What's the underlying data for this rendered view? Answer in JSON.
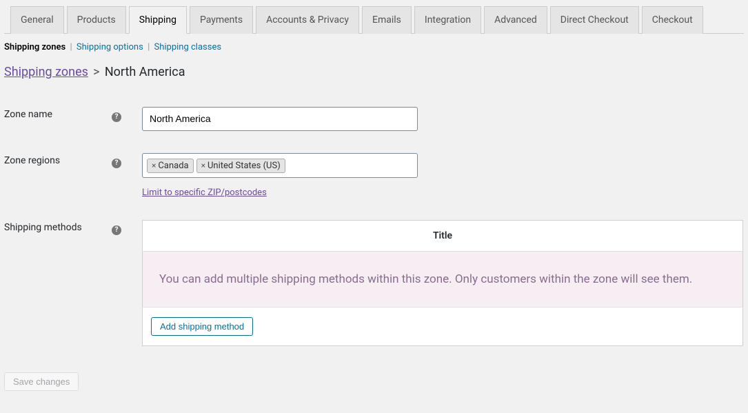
{
  "tabs": [
    "General",
    "Products",
    "Shipping",
    "Payments",
    "Accounts & Privacy",
    "Emails",
    "Integration",
    "Advanced",
    "Direct Checkout",
    "Checkout"
  ],
  "active_tab_index": 2,
  "subnav": {
    "items": [
      "Shipping zones",
      "Shipping options",
      "Shipping classes"
    ],
    "current_index": 0
  },
  "breadcrumb": {
    "root": "Shipping zones",
    "current": "North America"
  },
  "form": {
    "zone_name": {
      "label": "Zone name",
      "value": "North America"
    },
    "zone_regions": {
      "label": "Zone regions",
      "chips": [
        "Canada",
        "United States (US)"
      ],
      "limit_link": "Limit to specific ZIP/postcodes"
    },
    "shipping_methods": {
      "label": "Shipping methods",
      "table_header": "Title",
      "placeholder": "You can add multiple shipping methods within this zone. Only customers within the zone will see them.",
      "add_button": "Add shipping method"
    }
  },
  "save_button": "Save changes"
}
